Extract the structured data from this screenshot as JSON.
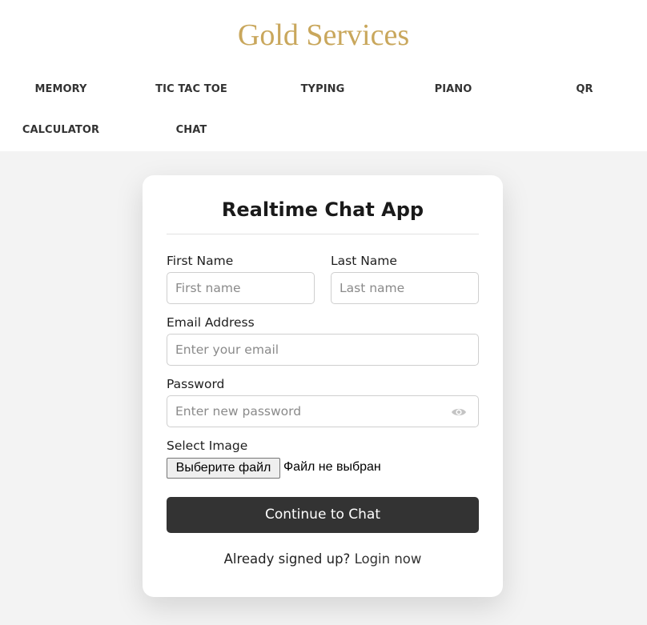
{
  "header": {
    "brand": "Gold Services",
    "nav": [
      {
        "label": "MEMORY"
      },
      {
        "label": "TIC TAC TOE"
      },
      {
        "label": "TYPING"
      },
      {
        "label": "PIANO"
      },
      {
        "label": "QR"
      },
      {
        "label": "CALCULATOR"
      },
      {
        "label": "CHAT"
      }
    ]
  },
  "form": {
    "title": "Realtime Chat App",
    "first_name": {
      "label": "First Name",
      "placeholder": "First name",
      "value": ""
    },
    "last_name": {
      "label": "Last Name",
      "placeholder": "Last name",
      "value": ""
    },
    "email": {
      "label": "Email Address",
      "placeholder": "Enter your email",
      "value": ""
    },
    "password": {
      "label": "Password",
      "placeholder": "Enter new password",
      "value": "",
      "icon": "eye-icon"
    },
    "image": {
      "label": "Select Image",
      "button": "Выберите файл",
      "status": "Файл не выбран"
    },
    "submit": "Continue to Chat",
    "footer_text": "Already signed up?",
    "footer_link": "Login now"
  },
  "colors": {
    "brand": "#c9a75c",
    "page_bg": "#f3f3f3",
    "button_bg": "#333333",
    "card_bg": "#ffffff"
  }
}
